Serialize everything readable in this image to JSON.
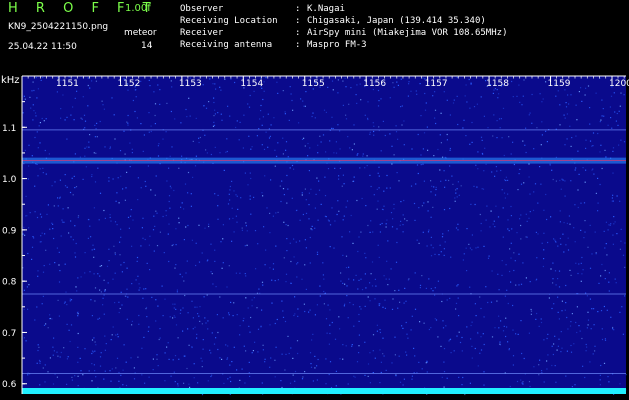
{
  "header": {
    "app_title": "H R O F F T",
    "version": "1.00f",
    "filename": "KN9_2504221150.png",
    "datetime": "25.04.22 11:50",
    "meteor_label": "meteor",
    "meteor_count": "14",
    "info": [
      {
        "label": "Observer",
        "value": "K.Nagai"
      },
      {
        "label": "Receiving Location",
        "value": "Chigasaki, Japan (139.414 35.340)"
      },
      {
        "label": "Receiver",
        "value": "AirSpy mini (Miakejima VOR 108.65MHz)"
      },
      {
        "label": "Receiving antenna",
        "value": "Maspro FM-3"
      }
    ]
  },
  "chart_data": {
    "type": "heatmap",
    "xlabel": "",
    "ylabel": "kHz",
    "x_ticks": [
      "1151",
      "1152",
      "1153",
      "1154",
      "1155",
      "1156",
      "1157",
      "1158",
      "1159",
      "1200"
    ],
    "y_ticks": [
      1.1,
      1.0,
      0.9,
      0.8,
      0.7,
      0.6
    ],
    "ylim": [
      0.58,
      1.2
    ],
    "carrier_khz": 1.035,
    "faint_lines_khz": [
      1.095,
      0.775,
      0.62
    ],
    "colors": {
      "background": "#0a0a8c",
      "noise": "#2a5cff",
      "carrier": "#ffe060",
      "carrier_peak": "#ff3060",
      "axis": "#ffffff",
      "bottom_band": "#20f0ff"
    }
  }
}
